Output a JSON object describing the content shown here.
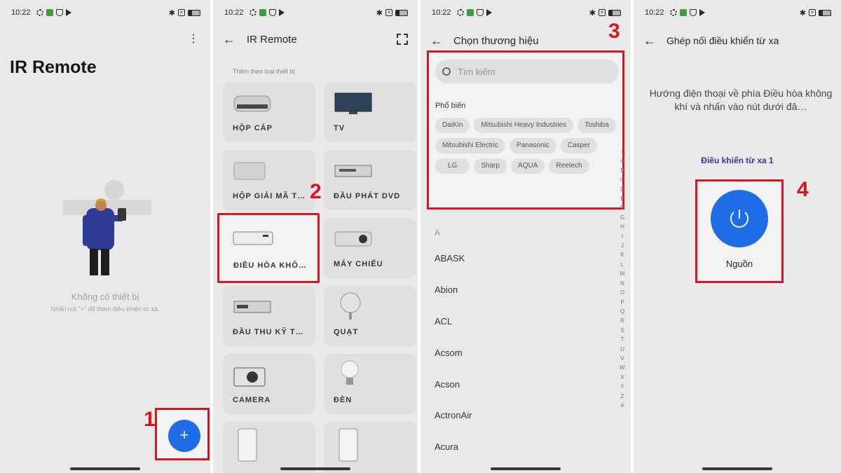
{
  "status_time": "10:22",
  "accent_color": "#1a6ef2",
  "highlight_color": "#e0121b",
  "panel1": {
    "title": "IR Remote",
    "menu_icon": "more-vertical-icon",
    "empty_title": "Không có thiết bị",
    "empty_hint": "Nhấn nút \"+\" để thêm điều khiển từ xa.",
    "fab_label": "+",
    "step": "1"
  },
  "panel2": {
    "title": "IR Remote",
    "section_label": "Thêm theo loại thiết bị",
    "step": "2",
    "tiles": [
      {
        "label": "HỘP CÁP"
      },
      {
        "label": "TV"
      },
      {
        "label": "HỘP GIẢI MÃ T…"
      },
      {
        "label": "ĐẦU PHÁT DVD"
      },
      {
        "label": "ĐIỀU HÒA KHÔ…"
      },
      {
        "label": "MÁY CHIẾU"
      },
      {
        "label": "ĐẦU THU KỸ T…"
      },
      {
        "label": "QUẠT"
      },
      {
        "label": "CAMERA"
      },
      {
        "label": "ĐÈN"
      }
    ]
  },
  "panel3": {
    "title": "Chọn thương hiệu",
    "step": "3",
    "search_placeholder": "Tìm kiếm",
    "popular_label": "Phổ biến",
    "popular_brands": [
      "DaiKin",
      "Mitsubishi Heavy Industries",
      "Toshiba",
      "Mitsubishi Electric",
      "Panasonic",
      "Casper",
      "LG",
      "Sharp",
      "AQUA",
      "Reetech"
    ],
    "section_letter": "A",
    "brands": [
      "ABASK",
      "Abion",
      "ACL",
      "Acsom",
      "Acson",
      "ActronAir",
      "Acura"
    ],
    "alphabet": [
      "☆",
      "A",
      "B",
      "C",
      "D",
      "E",
      "F",
      "G",
      "H",
      "I",
      "J",
      "K",
      "L",
      "M",
      "N",
      "O",
      "P",
      "Q",
      "R",
      "S",
      "T",
      "U",
      "V",
      "W",
      "X",
      "Y",
      "Z",
      "#"
    ]
  },
  "panel4": {
    "title": "Ghép nối điều khiển từ xa",
    "instruction": "Hướng điện thoại về phía Điều hòa không khí và nhấn vào nút dưới đâ…",
    "remote_label": "Điều khiển từ xa 1",
    "power_label": "Nguồn",
    "step": "4"
  }
}
